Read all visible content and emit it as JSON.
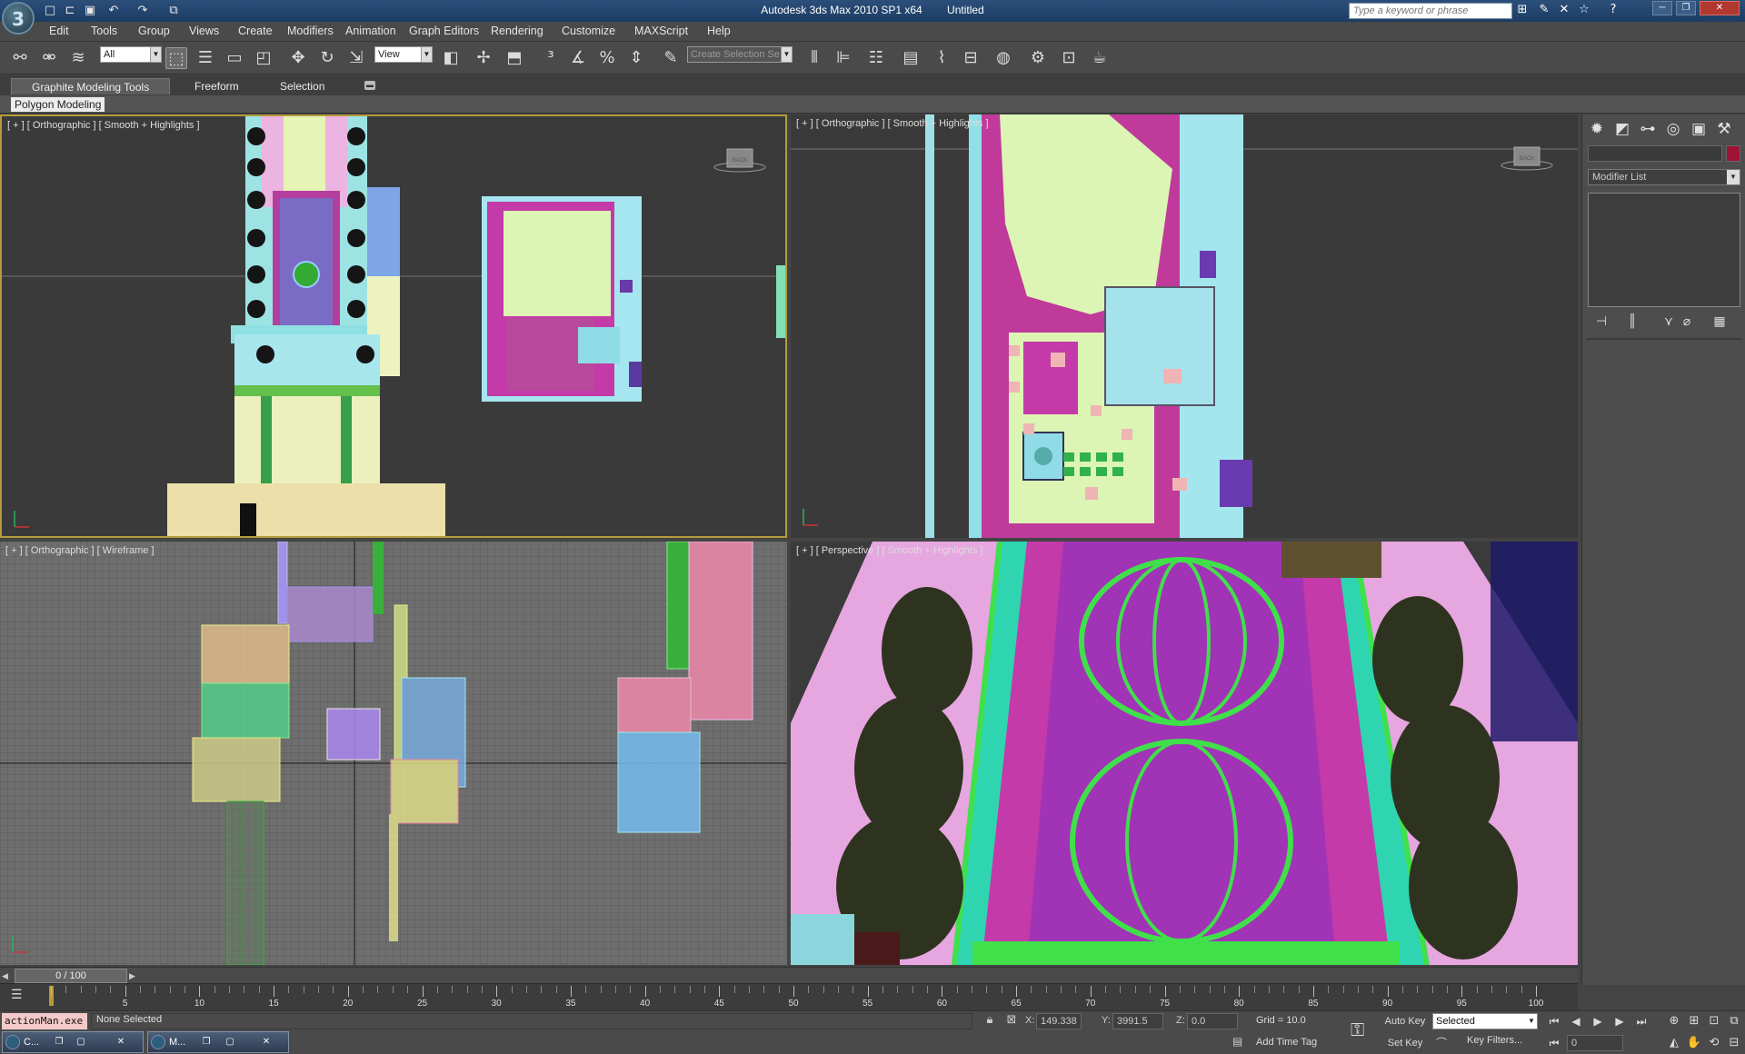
{
  "window": {
    "app_title": "Autodesk 3ds Max  2010 SP1 x64",
    "doc_title": "Untitled",
    "search_placeholder": "Type a keyword or phrase"
  },
  "menu": [
    "Edit",
    "Tools",
    "Group",
    "Views",
    "Create",
    "Modifiers",
    "Animation",
    "Graph Editors",
    "Rendering",
    "Customize",
    "MAXScript",
    "Help"
  ],
  "toolbar": {
    "selection_filter": "All",
    "reference_coord": "View",
    "named_selection_placeholder": "Create Selection Se"
  },
  "ribbon": {
    "tabs": [
      "Graphite Modeling Tools",
      "Freeform",
      "Selection"
    ],
    "panel_label": "Polygon Modeling"
  },
  "viewports": {
    "top_left_label": "[ + ] [ Orthographic ] [ Smooth + Highlights ]",
    "top_right_label": "[ + ] [ Orthographic ] [ Smooth + Highlights ]",
    "bottom_left_label": "[ + ] [ Orthographic ] [ Wireframe ]",
    "bottom_right_label": "[ + ] [ Perspective ] [ Smooth + Highlights ]",
    "viewcube_face": "BACK"
  },
  "command_panel": {
    "modifier_list": "Modifier List",
    "object_color": "#a01236"
  },
  "timeline": {
    "time_slider": "0 / 100",
    "ticks": [
      "5",
      "10",
      "15",
      "20",
      "25",
      "30",
      "35",
      "40",
      "45",
      "50",
      "55",
      "60",
      "65",
      "70",
      "75",
      "80",
      "85",
      "90",
      "95",
      "100"
    ]
  },
  "status": {
    "maxscript_text": "actionMan.exe",
    "selection": "None Selected",
    "x_label": "X:",
    "x_value": "149.338",
    "y_label": "Y:",
    "y_value": "3991.5",
    "z_label": "Z:",
    "z_value": "0.0",
    "grid": "Grid = 10.0",
    "add_time_tag": "Add Time Tag",
    "auto_key": "Auto Key",
    "set_key": "Set Key",
    "key_mode_dropdown": "Selected",
    "key_filters": "Key Filters...",
    "current_frame": "0"
  },
  "taskbar": [
    "C...",
    "M..."
  ],
  "colors": {
    "active_viewport_border": "#b49c3c",
    "title_bar": "#2b4f7a",
    "scene_magenta": "#b02a9a",
    "scene_lime": "#d8f0b0",
    "scene_cyan": "#9fe0e8"
  }
}
